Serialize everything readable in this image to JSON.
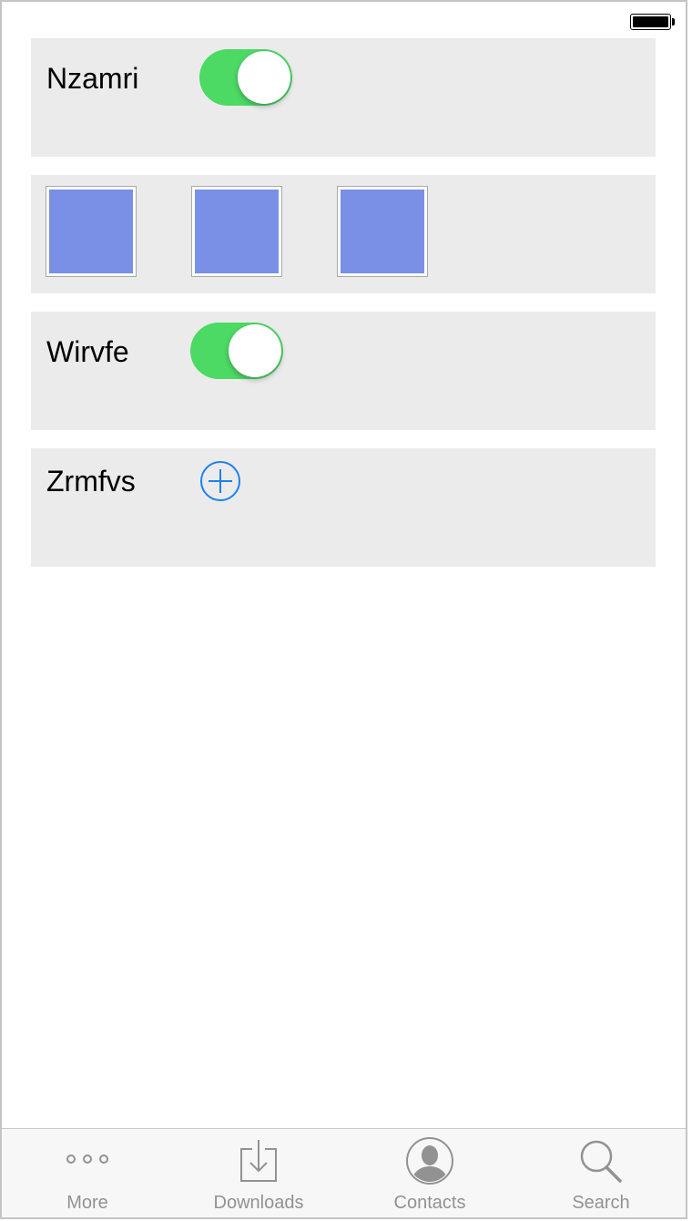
{
  "status_bar": {
    "battery_level": 1.0
  },
  "cards": {
    "nzamri": {
      "label": "Nzamri",
      "toggle_on": true
    },
    "swatches": {
      "color": "#7990e6",
      "count": 3
    },
    "wirvfe": {
      "label": "Wirvfe",
      "toggle_on": true
    },
    "zrmfvs": {
      "label": "Zrmfvs",
      "add_icon": "plus-circle-icon"
    }
  },
  "colors": {
    "toggle_on": "#4cd964",
    "accent_blue": "#1a82f0",
    "card_bg": "#ebebeb",
    "tab_inactive": "#929292"
  },
  "tab_bar": {
    "tabs": [
      {
        "label": "More",
        "icon": "more-icon"
      },
      {
        "label": "Downloads",
        "icon": "downloads-icon"
      },
      {
        "label": "Contacts",
        "icon": "contacts-icon"
      },
      {
        "label": "Search",
        "icon": "search-icon"
      }
    ]
  }
}
